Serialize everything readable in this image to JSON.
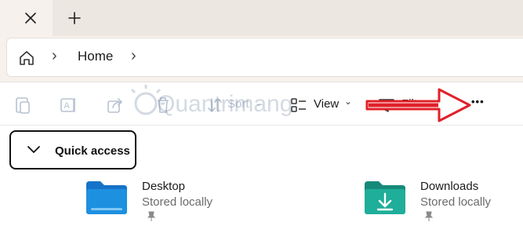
{
  "tabs": {
    "close_glyph": "✕",
    "new_tab_glyph": "+"
  },
  "breadcrumb": {
    "separator": "›",
    "items": [
      "Home"
    ]
  },
  "toolbar": {
    "sort_label": "Sort",
    "view_label": "View",
    "filter_label": "Filter",
    "more_glyph": "•••"
  },
  "watermark": "Quantrimang",
  "quick_access": {
    "label": "Quick access"
  },
  "items": [
    {
      "name": "Desktop",
      "status": "Stored locally"
    },
    {
      "name": "Downloads",
      "status": "Stored locally"
    }
  ],
  "annotation": {
    "arrow_color": "#e0202a"
  },
  "colors": {
    "folder_blue": "#1e90e0",
    "folder_teal": "#1fae9a",
    "accent": "#e0202a"
  }
}
